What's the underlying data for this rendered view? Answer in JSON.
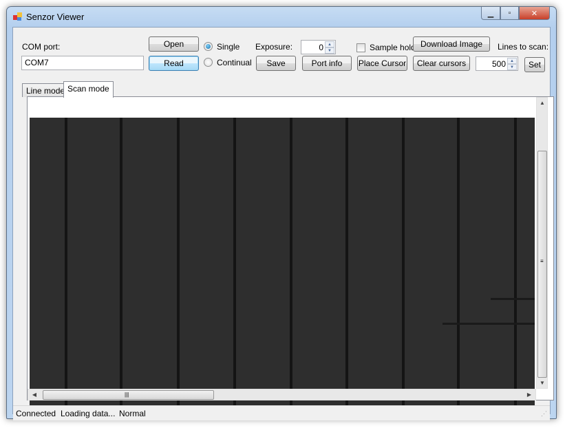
{
  "window": {
    "title": "Senzor Viewer",
    "minimize": "▁",
    "maximize": "▫",
    "close": "✕"
  },
  "toolbar": {
    "com_port_label": "COM port:",
    "com_port_value": "COM7",
    "open_label": "Open",
    "read_label": "Read",
    "mode_options": [
      {
        "label": "Single",
        "selected": true
      },
      {
        "label": "Continual",
        "selected": false
      }
    ],
    "exposure_label": "Exposure:",
    "exposure_value": "0",
    "save_label": "Save",
    "port_info_label": "Port info",
    "sample_hold_label": "Sample hold",
    "sample_hold_checked": false,
    "place_cursor_label": "Place Cursor",
    "download_image_label": "Download Image",
    "clear_cursors_label": "Clear cursors",
    "lines_to_scan_label": "Lines to scan:",
    "lines_to_scan_value": "500",
    "set_label": "Set"
  },
  "tabs": [
    {
      "label": "Line mode",
      "active": false
    },
    {
      "label": "Scan mode",
      "active": true
    }
  ],
  "scrollbars": {
    "up": "▲",
    "down": "▼",
    "left": "◀",
    "right": "▶",
    "grip": "≡"
  },
  "status": {
    "connection": "Connected",
    "loading": "Loading data...",
    "mode": "Normal"
  }
}
